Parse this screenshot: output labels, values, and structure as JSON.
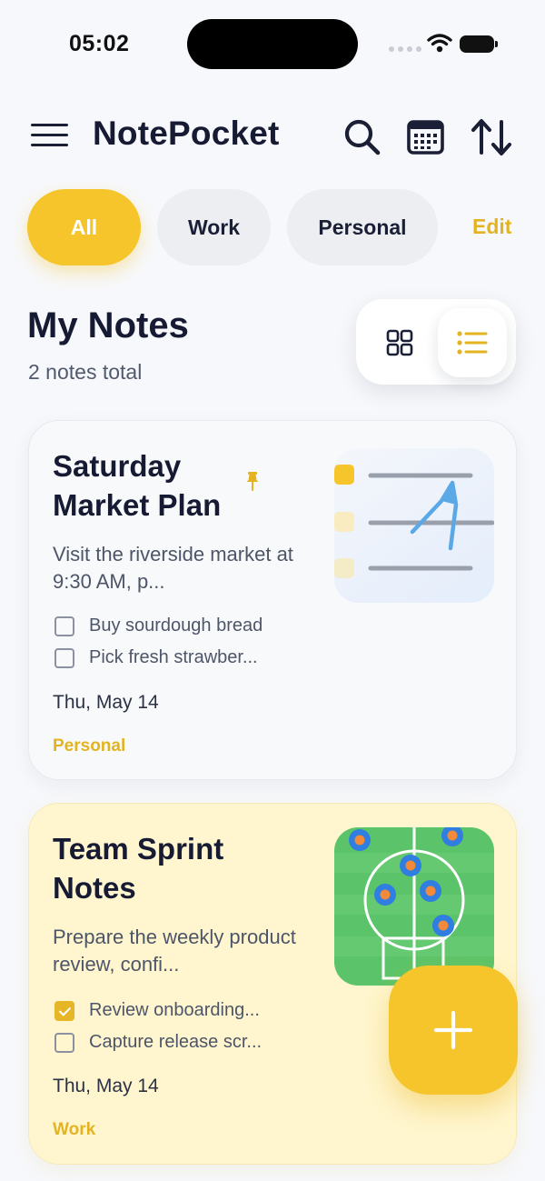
{
  "status_bar": {
    "time": "05:02",
    "icons": [
      "signal-icon",
      "wifi-icon",
      "battery-icon"
    ]
  },
  "header": {
    "app_title": "NotePocket",
    "icons": [
      "menu-icon",
      "search-icon",
      "calendar-icon",
      "sort-icon"
    ]
  },
  "filters": {
    "chips": [
      {
        "label": "All",
        "active": true
      },
      {
        "label": "Work",
        "active": false
      },
      {
        "label": "Personal",
        "active": false
      }
    ],
    "edit_label": "Edit"
  },
  "section": {
    "title": "My Notes",
    "subtitle": "2 notes total",
    "view_modes": [
      {
        "icon": "grid-view-icon",
        "active": false
      },
      {
        "icon": "list-view-icon",
        "active": true
      }
    ]
  },
  "notes": [
    {
      "title": "Saturday Market Plan",
      "pinned": true,
      "preview": "Visit the riverside market at 9:30 AM, p...",
      "checklist": [
        {
          "text": "Buy sourdough bread",
          "checked": false
        },
        {
          "text": "Pick fresh strawber...",
          "checked": false
        }
      ],
      "date": "Thu, May 14",
      "tag": "Personal",
      "thumbnail": "checklist-sketch-thumbnail"
    },
    {
      "title": "Team Sprint Notes",
      "pinned": false,
      "preview": "Prepare the weekly product review, confi...",
      "checklist": [
        {
          "text": "Review onboarding...",
          "checked": true
        },
        {
          "text": "Capture release scr...",
          "checked": false
        }
      ],
      "date": "Thu, May 14",
      "tag": "Work",
      "thumbnail": "soccer-field-thumbnail"
    }
  ],
  "fab": {
    "icon": "plus-icon"
  },
  "colors": {
    "accent": "#f5c52b",
    "accent_text": "#e3b322",
    "background": "#f7f8fb",
    "work_card": "#fff6cf",
    "personal_card": "#f8f9fb",
    "text_primary": "#161b33"
  }
}
